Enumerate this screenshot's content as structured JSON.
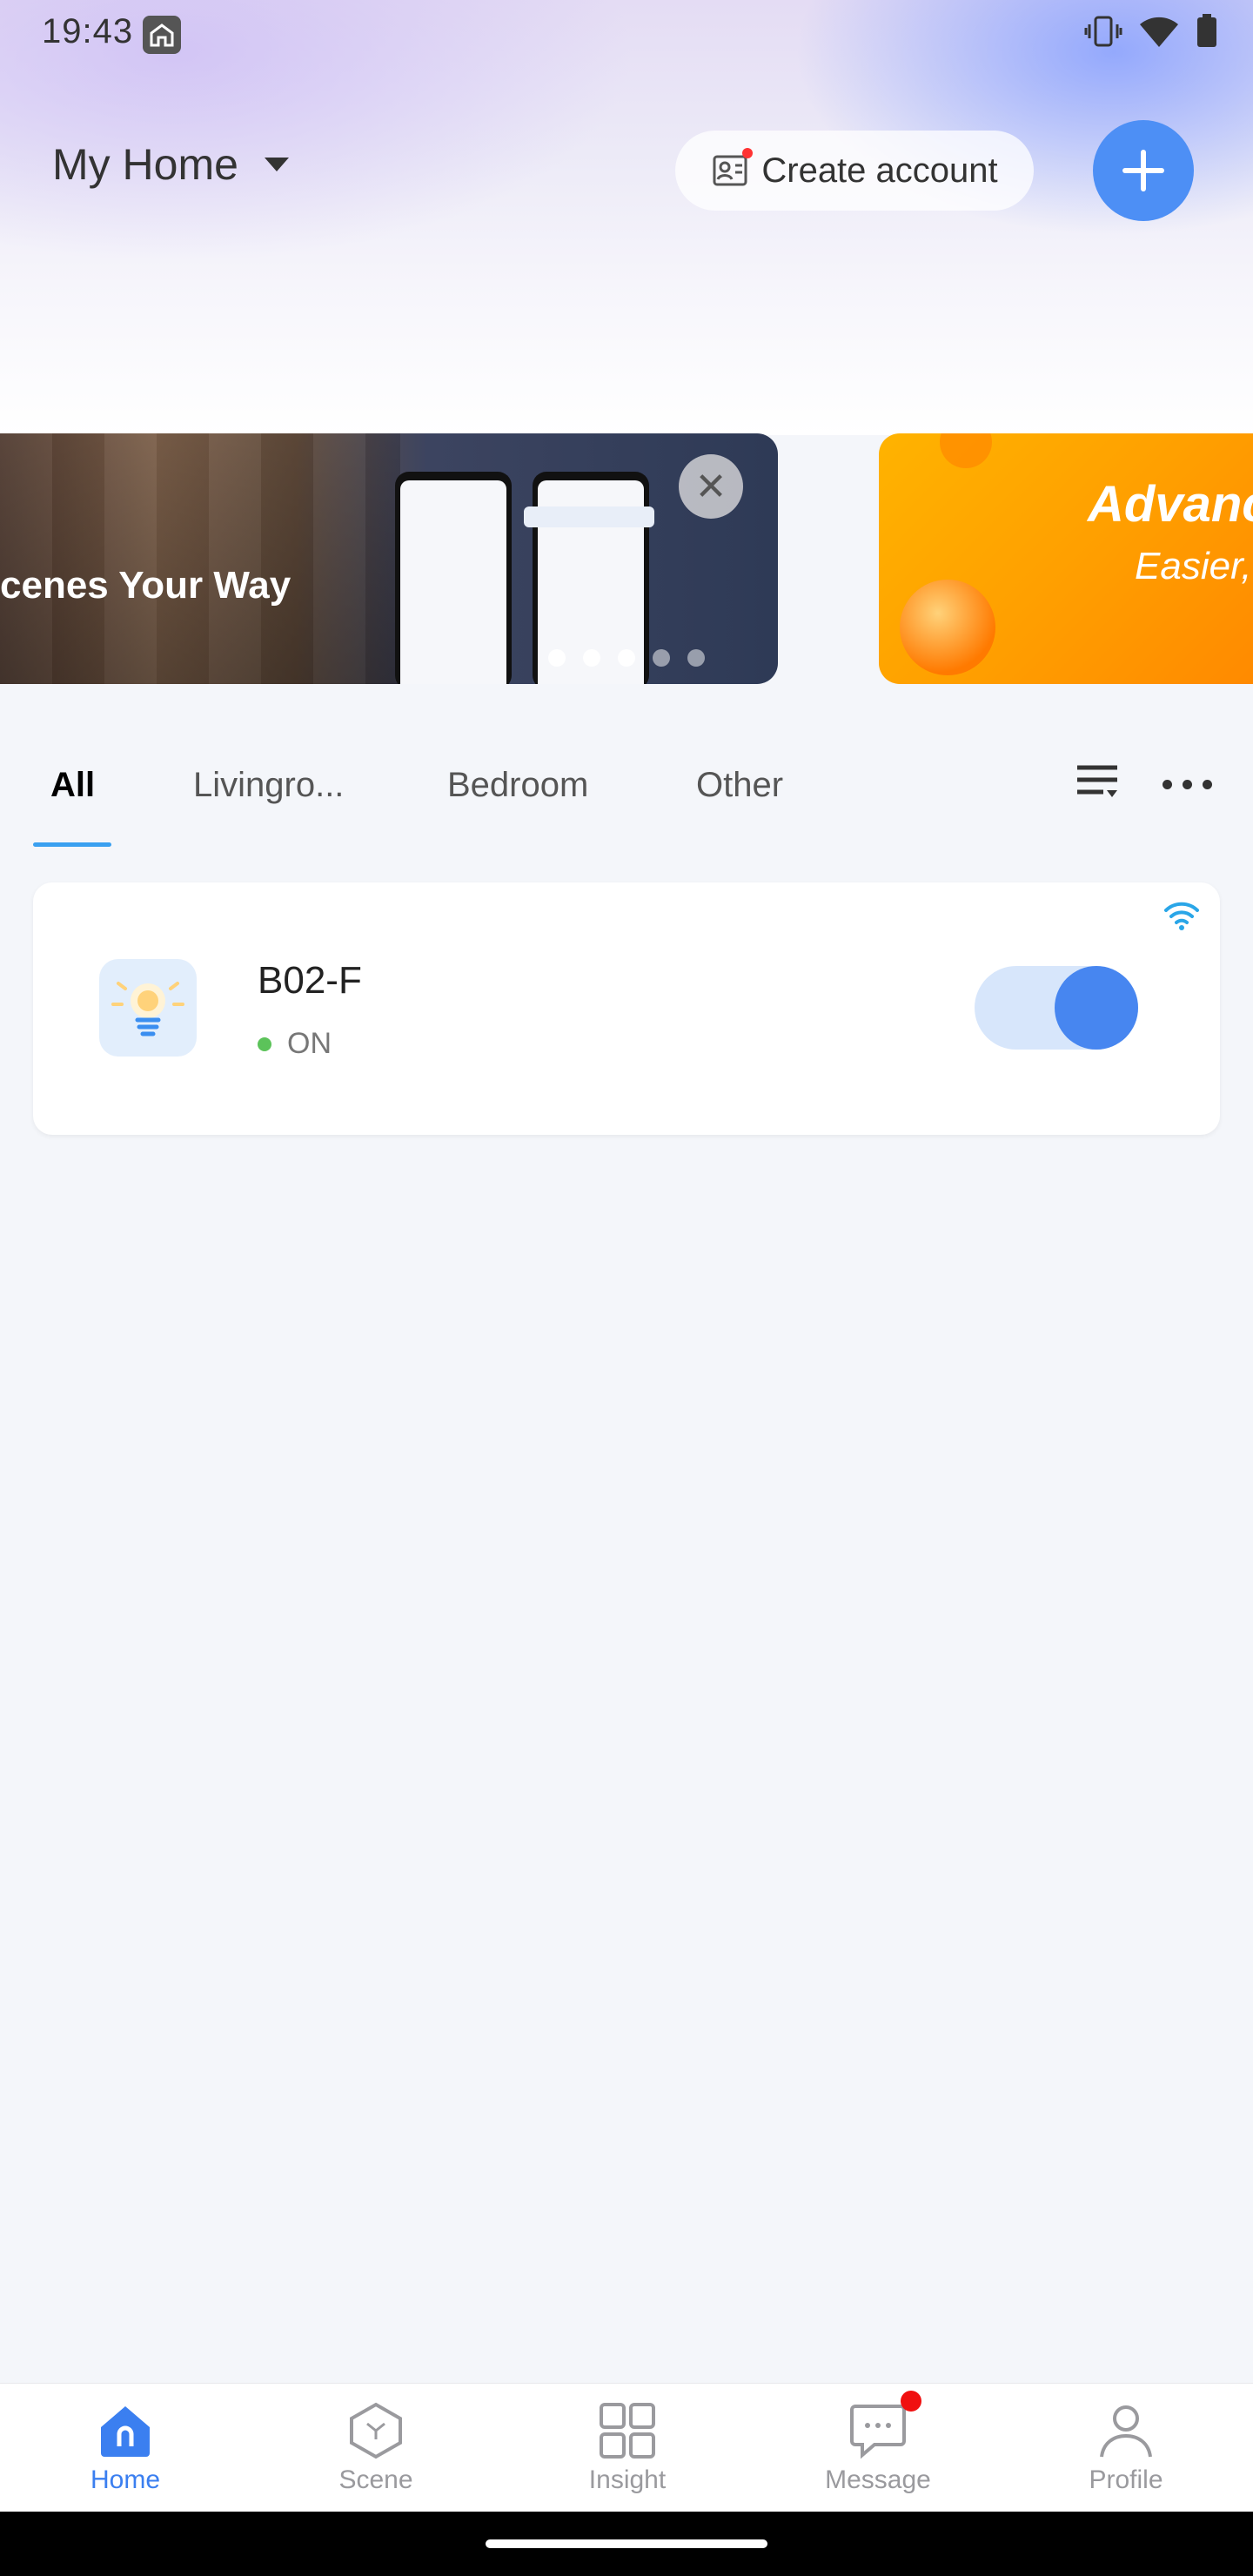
{
  "status_bar": {
    "time": "19:43"
  },
  "header": {
    "home_name": "My Home",
    "create_account_label": "Create account"
  },
  "banners": [
    {
      "title": "cenes Your Way"
    },
    {
      "title": "Advanc",
      "subtitle": "Easier,"
    }
  ],
  "tabs": [
    {
      "label": "All",
      "active": true
    },
    {
      "label": "Livingro..."
    },
    {
      "label": "Bedroom"
    },
    {
      "label": "Other"
    }
  ],
  "devices": [
    {
      "name": "B02-F",
      "status": "ON",
      "toggle_on": true
    }
  ],
  "bottom_nav": [
    {
      "label": "Home",
      "icon": "home-icon",
      "active": true
    },
    {
      "label": "Scene",
      "icon": "scene-icon"
    },
    {
      "label": "Insight",
      "icon": "insight-icon"
    },
    {
      "label": "Message",
      "icon": "message-icon",
      "badge": true
    },
    {
      "label": "Profile",
      "icon": "profile-icon"
    }
  ],
  "colors": {
    "accent": "#4d8ff5",
    "tab_underline": "#3aa0f0",
    "online": "#5cc35a",
    "badge": "#f01010"
  }
}
